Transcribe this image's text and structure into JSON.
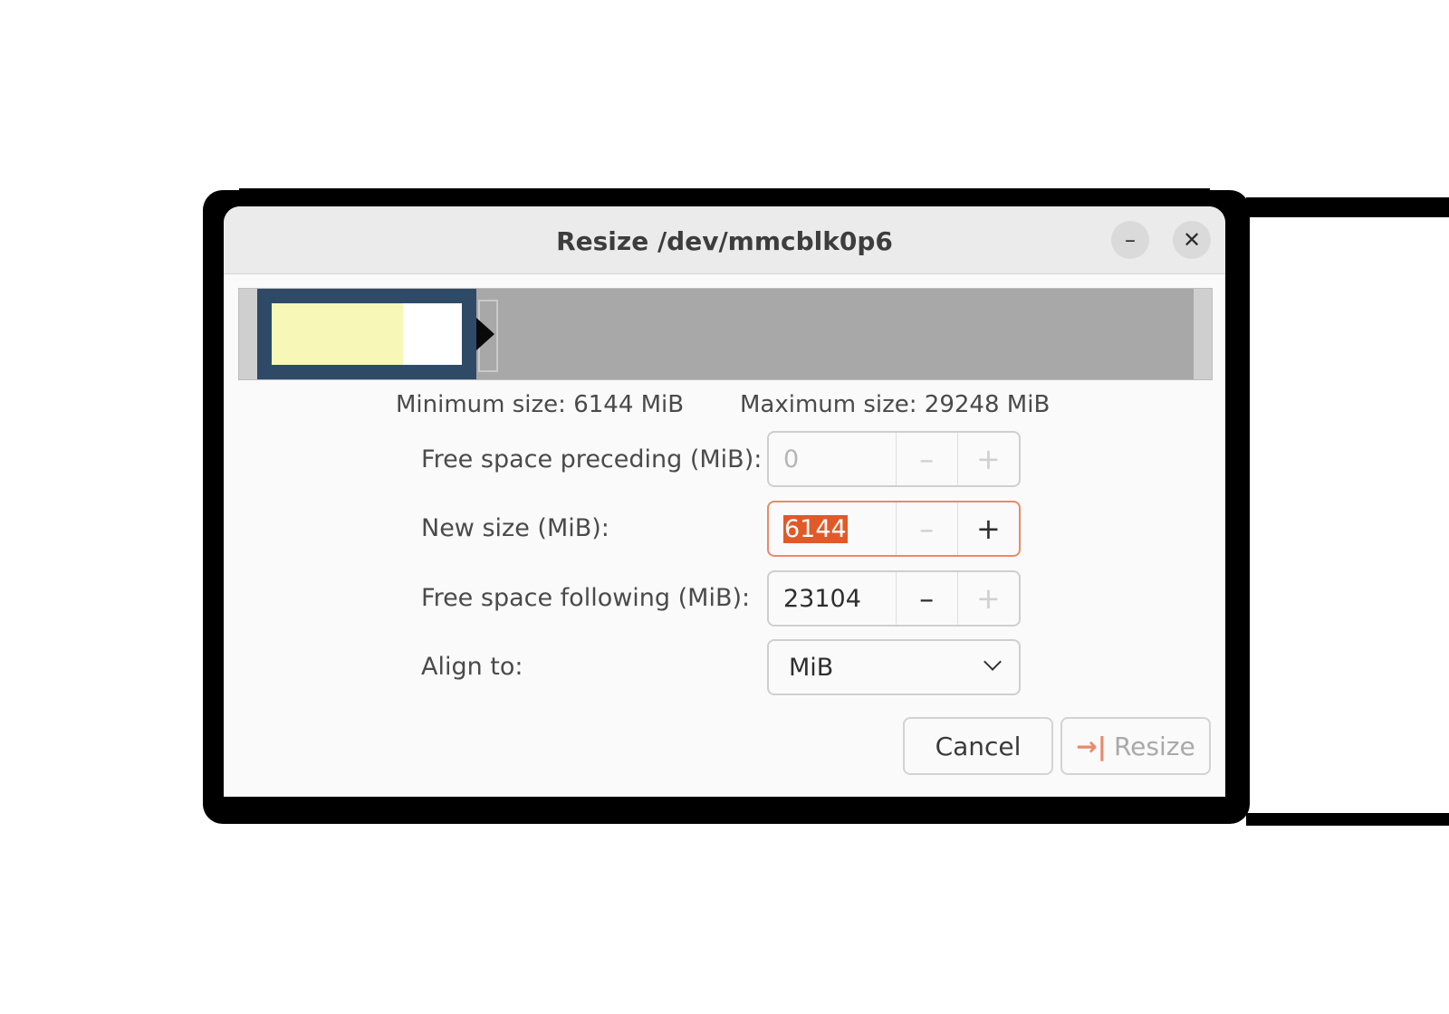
{
  "window": {
    "title": "Resize /dev/mmcblk0p6",
    "minimize_symbol": "–",
    "close_symbol": "✕"
  },
  "graph": {
    "used_fraction": 0.69,
    "colors": {
      "partition_border": "#2f4a66",
      "used": "#f7f7b8",
      "unused": "#ffffff",
      "unallocated": "#a8a8a8"
    }
  },
  "info": {
    "minimum": "Minimum size: 6144 MiB",
    "maximum": "Maximum size: 29248 MiB"
  },
  "fields": {
    "preceding": {
      "label": "Free space preceding (MiB):",
      "value": "0",
      "minus": "–",
      "plus": "+"
    },
    "new_size": {
      "label": "New size (MiB):",
      "value": "6144",
      "minus": "–",
      "plus": "+"
    },
    "following": {
      "label": "Free space following (MiB):",
      "value": "23104",
      "minus": "–",
      "plus": "+"
    },
    "align": {
      "label": "Align to:",
      "value": "MiB"
    }
  },
  "buttons": {
    "cancel": "Cancel",
    "resize": "Resize",
    "resize_icon": "→|"
  },
  "colors": {
    "accent": "#e98a6a",
    "selection": "#e05a28"
  }
}
